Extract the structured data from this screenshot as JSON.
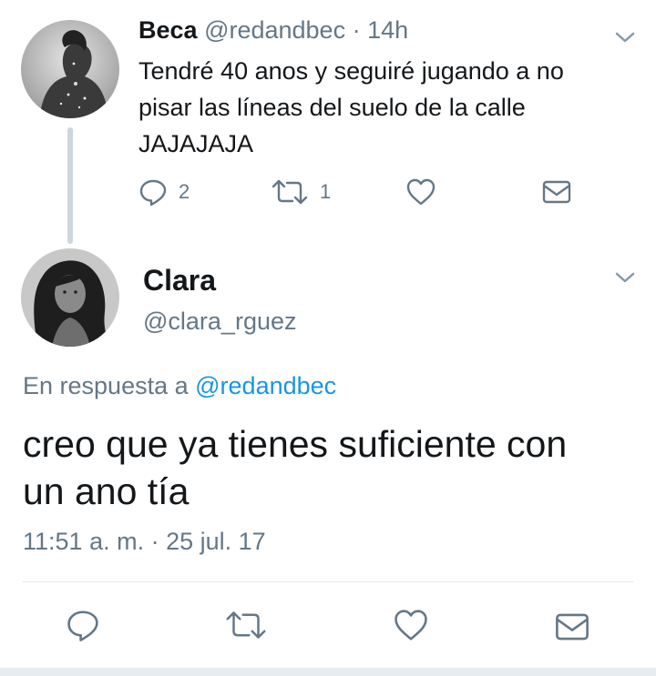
{
  "reply_tweet": {
    "name": "Beca",
    "handle": "@redandbec",
    "separator": "·",
    "time_ago": "14h",
    "text_line1": "Tendré 40 anos y seguiré jugando a no",
    "text_line2": "pisar las líneas del suelo de la calle",
    "text_line3": "JAJAJAJA",
    "reply_count": "2",
    "retweet_count": "1",
    "icons": [
      "reply-icon",
      "retweet-icon",
      "like-icon",
      "direct-message-icon",
      "chevron-down-icon"
    ]
  },
  "main_tweet": {
    "name": "Clara",
    "handle": "@clara_rguez",
    "in_reply_prefix": "En respuesta a",
    "in_reply_handle": "@redandbec",
    "text_line1": "creo que ya tienes suficiente con",
    "text_line2": "un ano tía",
    "timestamp": "11:51 a. m. · 25 jul. 17",
    "icons": [
      "reply-icon",
      "retweet-icon",
      "like-icon",
      "direct-message-icon",
      "chevron-down-icon"
    ]
  },
  "colors": {
    "text": "#14171a",
    "muted": "#657786",
    "link": "#1b95e0",
    "thread_line": "#ccd6dd",
    "divider": "#e1e8ed"
  }
}
